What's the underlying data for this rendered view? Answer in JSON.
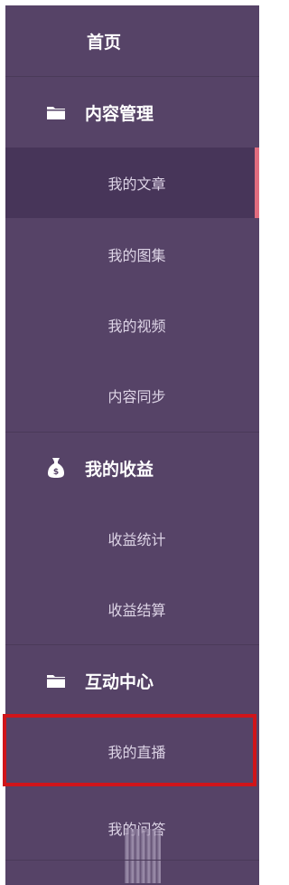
{
  "colors": {
    "sidebar_bg": "#564367",
    "active_bg": "#473559",
    "active_accent": "#e06c7f",
    "highlight_border": "#d0151a",
    "top_text": "#ffffff",
    "sub_text": "#ddd4e6"
  },
  "sidebar": {
    "home": {
      "label": "首页"
    },
    "groups": [
      {
        "icon": "folder-icon",
        "label": "内容管理",
        "items": [
          {
            "label": "我的文章",
            "active": true
          },
          {
            "label": "我的图集"
          },
          {
            "label": "我的视频"
          },
          {
            "label": "内容同步"
          }
        ]
      },
      {
        "icon": "money-bag-icon",
        "label": "我的收益",
        "items": [
          {
            "label": "收益统计"
          },
          {
            "label": "收益结算"
          }
        ]
      },
      {
        "icon": "folder-icon",
        "label": "互动中心",
        "items": [
          {
            "label": "我的直播",
            "highlighted": true
          },
          {
            "label": "我的问答"
          }
        ]
      }
    ]
  }
}
